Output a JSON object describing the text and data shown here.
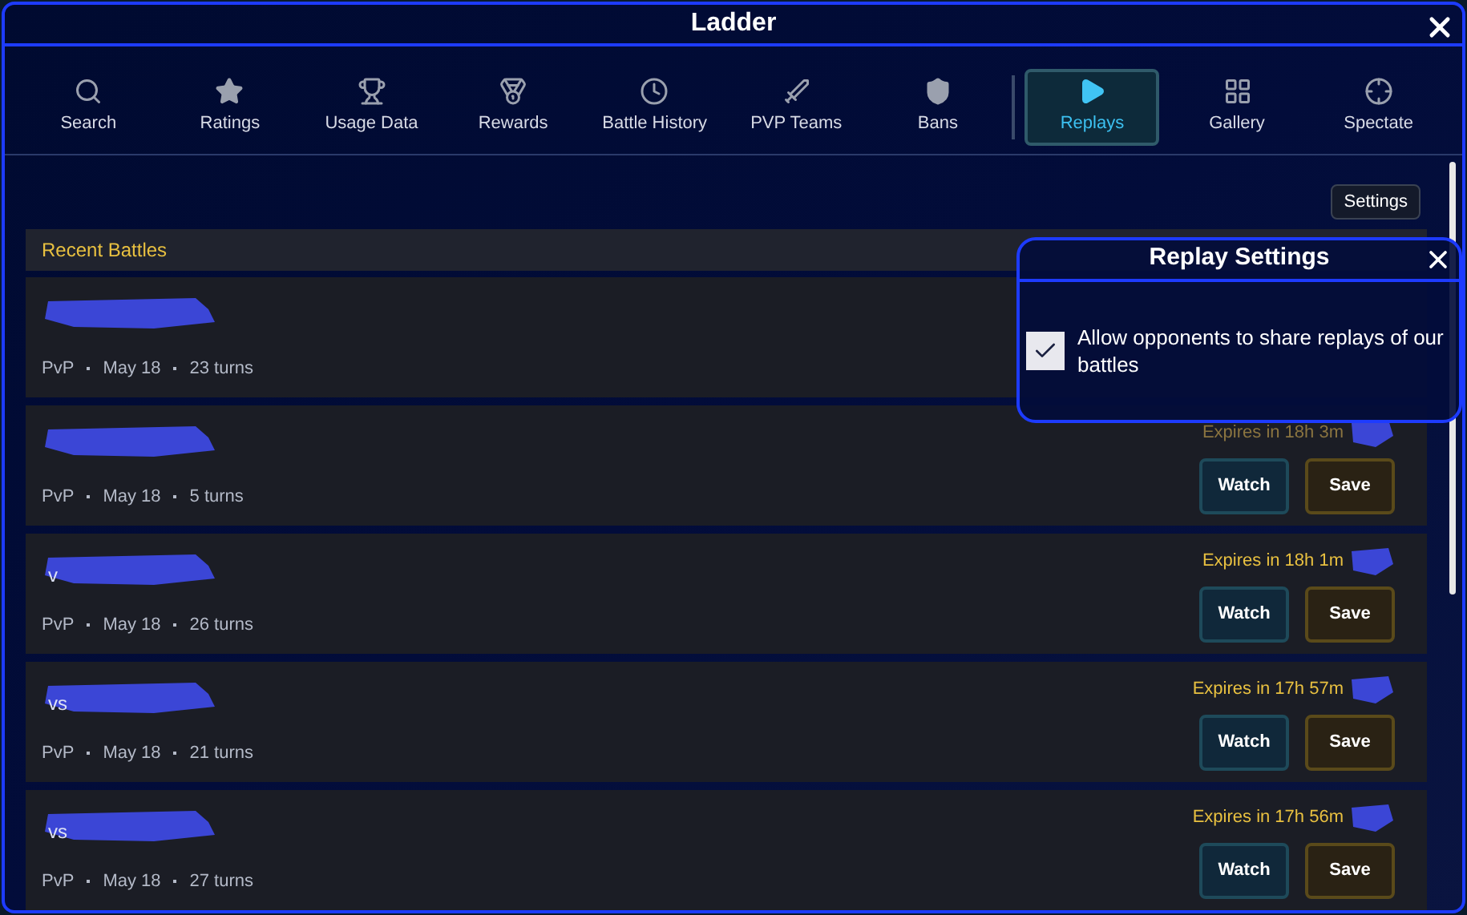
{
  "window": {
    "title": "Ladder"
  },
  "tabs": [
    {
      "label": "Search",
      "selected": false
    },
    {
      "label": "Ratings",
      "selected": false
    },
    {
      "label": "Usage Data",
      "selected": false
    },
    {
      "label": "Rewards",
      "selected": false
    },
    {
      "label": "Battle History",
      "selected": false
    },
    {
      "label": "PVP Teams",
      "selected": false
    },
    {
      "label": "Bans",
      "selected": false
    },
    {
      "label": "Replays",
      "selected": true
    },
    {
      "label": "Gallery",
      "selected": false
    },
    {
      "label": "Spectate",
      "selected": false
    }
  ],
  "settings_button": "Settings",
  "section_title": "Recent Battles",
  "battles": [
    {
      "meta": [
        "PvP",
        "May 18",
        "23 turns"
      ]
    },
    {
      "meta": [
        "PvP",
        "May 18",
        "5 turns"
      ],
      "expires": "Expires in 18h 3m",
      "dim": true,
      "watch": "Watch",
      "save": "Save"
    },
    {
      "name": "v",
      "meta": [
        "PvP",
        "May 18",
        "26 turns"
      ],
      "expires": "Expires in 18h 1m",
      "dim": false,
      "watch": "Watch",
      "save": "Save"
    },
    {
      "name": "vs",
      "meta": [
        "PvP",
        "May 18",
        "21 turns"
      ],
      "expires": "Expires in 17h 57m",
      "dim": false,
      "watch": "Watch",
      "save": "Save"
    },
    {
      "name": "vs",
      "meta": [
        "PvP",
        "May 18",
        "27 turns"
      ],
      "expires": "Expires in 17h 56m",
      "dim": false,
      "watch": "Watch",
      "save": "Save"
    }
  ],
  "popup": {
    "title": "Replay Settings",
    "option": {
      "label": "Allow opponents to share replays of our battles",
      "checked": true
    }
  }
}
